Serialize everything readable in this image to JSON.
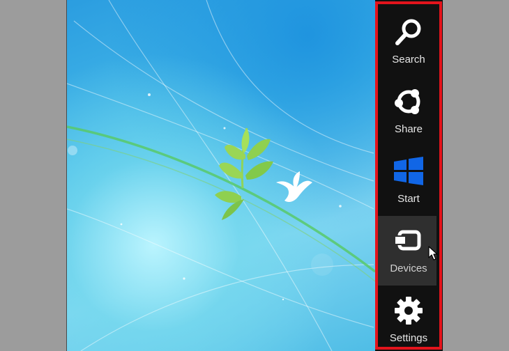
{
  "charms": [
    {
      "label": "Search",
      "icon": "search-icon",
      "state": "normal"
    },
    {
      "label": "Share",
      "icon": "share-icon",
      "state": "normal"
    },
    {
      "label": "Start",
      "icon": "windows-logo-icon",
      "state": "normal"
    },
    {
      "label": "Devices",
      "icon": "devices-icon",
      "state": "hovered"
    },
    {
      "label": "Settings",
      "icon": "gear-icon",
      "state": "normal"
    }
  ],
  "colors": {
    "charms_background": "#111111",
    "hover_background": "#2f2f2f",
    "start_logo": "#1166e6",
    "highlight_border": "#e3141c",
    "outer_background": "#9c9c9c"
  },
  "wallpaper": "light blue with green plant and white bird"
}
